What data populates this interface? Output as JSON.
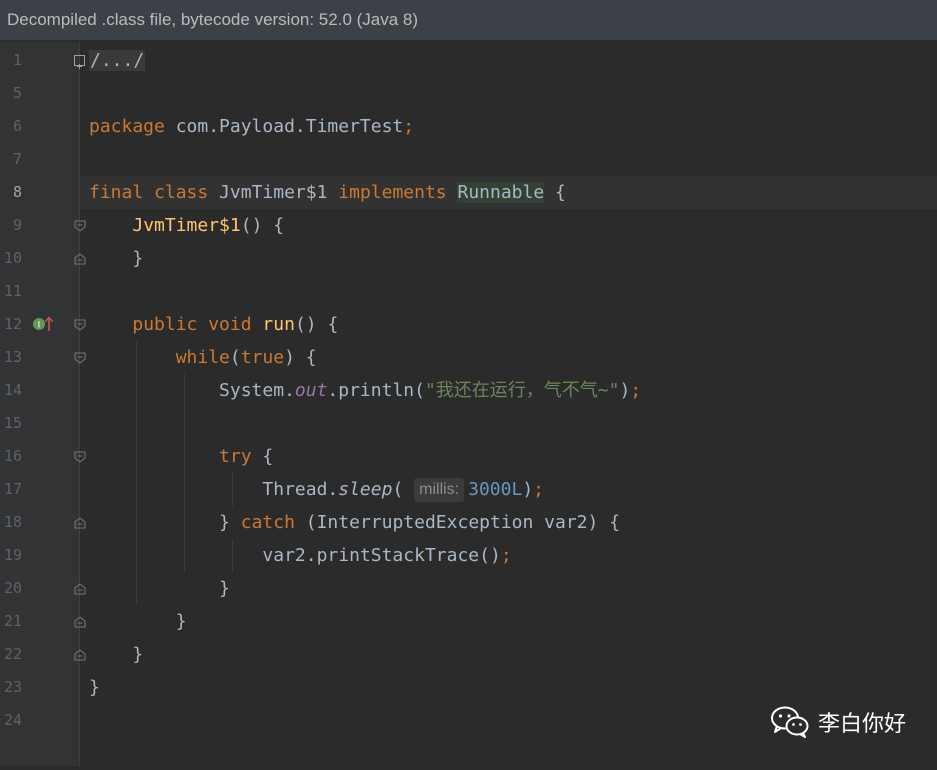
{
  "banner": {
    "text": "Decompiled .class file, bytecode version: 52.0 (Java 8)"
  },
  "gutter": {
    "line_numbers": [
      "1",
      "5",
      "6",
      "7",
      "8",
      "9",
      "10",
      "11",
      "12",
      "13",
      "14",
      "15",
      "16",
      "17",
      "18",
      "19",
      "20",
      "21",
      "22",
      "23",
      "24"
    ],
    "current_line": "8"
  },
  "code": {
    "collapsed_header": "/.../",
    "package_kw": "package",
    "package_name": " com.Payload.TimerTest",
    "semicolon": ";",
    "final_kw": "final class",
    "class_name": " JvmTimer$1 ",
    "implements_kw": "implements",
    "runnable": "Runnable",
    "open_brace": " {",
    "ctor_name": "JvmTimer$1",
    "ctor_rest": "() {",
    "close_brace": "}",
    "public_void": "public void",
    "run_name": "run",
    "run_rest": "() {",
    "while_kw": "while",
    "paren_open": "(",
    "true_kw": "true",
    "while_rest": ") {",
    "system": "System.",
    "out": "out",
    "println": ".println(",
    "string_literal": "\"我还在运行，气不气~\"",
    "call_close": ")",
    "try_kw": "try",
    "try_rest": " {",
    "thread": "Thread.",
    "sleep": "sleep",
    "sleep_open": "(",
    "param_hint": "millis:",
    "sleep_arg": "3000L",
    "catch_open": "} ",
    "catch_kw": "catch",
    "catch_rest": " (InterruptedException var2) {",
    "print_stack": "var2.printStackTrace()"
  },
  "watermark": {
    "text": "李白你好",
    "icon": "wechat-icon"
  },
  "colors": {
    "keyword": "#cc7832",
    "function": "#ffc66d",
    "string": "#6a8759",
    "number": "#6897bb",
    "static_field": "#9876aa",
    "text": "#a9b7c6"
  }
}
